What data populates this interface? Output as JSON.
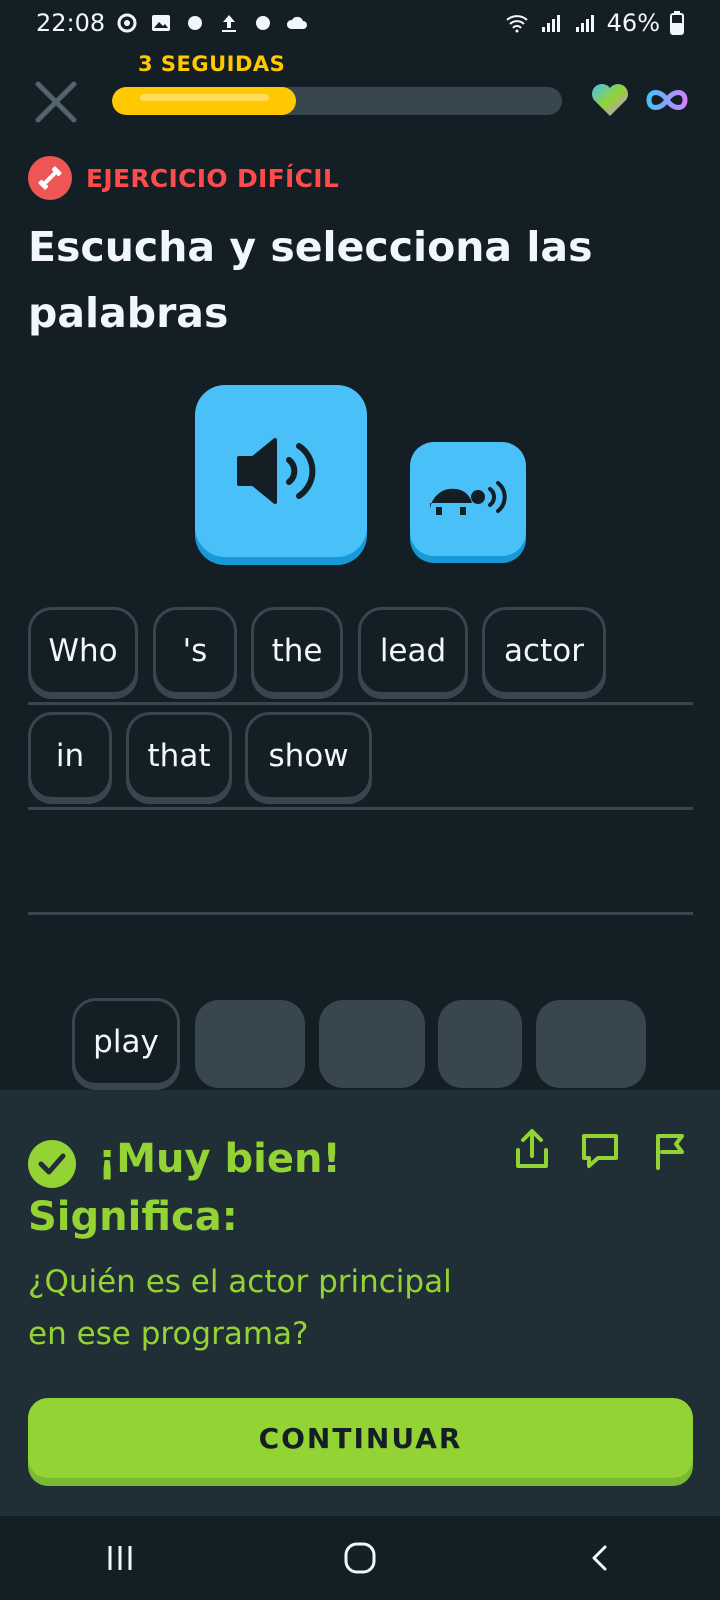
{
  "status_bar": {
    "time": "22:08",
    "battery": "46%"
  },
  "header": {
    "streak_label": "3 SEGUIDAS",
    "progress": 0.33
  },
  "challenge": {
    "badge_label": "EJERCICIO DIFÍCIL",
    "instruction": "Escucha y selecciona las palabras"
  },
  "answer_words": [
    "Who",
    "'s",
    "the",
    "lead",
    "actor",
    "in",
    "that",
    "show"
  ],
  "word_bank": [
    "play"
  ],
  "feedback": {
    "title": "¡Muy bien!",
    "subtitle": "Significa:",
    "meaning": "¿Quién es el actor principal en ese programa?"
  },
  "continue_label": "CONTINUAR",
  "colors": {
    "background": "#131f24",
    "accent_green": "#93d333",
    "accent_blue": "#49c0f8",
    "streak_yellow": "#ffc800",
    "error_red": "#ff4b4b"
  }
}
